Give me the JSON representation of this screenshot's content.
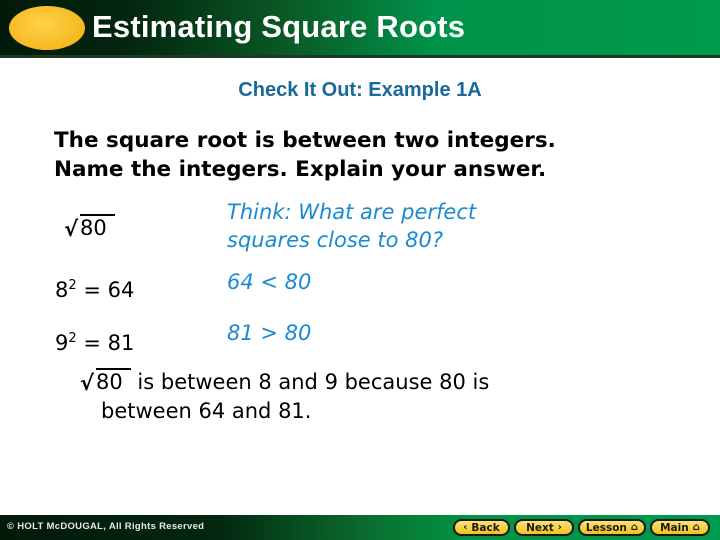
{
  "header": {
    "title": "Estimating Square Roots",
    "accent_color": "#f6b820"
  },
  "subtitle": "Check It Out: Example 1A",
  "prompt": {
    "line1": "The square root is between two integers.",
    "line2": "Name the integers. Explain your answer."
  },
  "work": {
    "radicand": "80",
    "think_line1": "Think: What are perfect",
    "think_line2": "squares close to 80?",
    "rows": [
      {
        "base": "8",
        "exp": "2",
        "rest": " = 64",
        "note": "64 < 80"
      },
      {
        "base": "9",
        "exp": "2",
        "rest": " = 81",
        "note": "81 > 80"
      }
    ]
  },
  "conclusion": {
    "radicand": "80",
    "line1_rest": " is between 8 and 9 because 80 is",
    "line2": "between 64 and 81."
  },
  "footer": {
    "copyright": "© HOLT McDOUGAL, All Rights Reserved",
    "buttons": [
      {
        "label": "Back",
        "icon": "chevron-left"
      },
      {
        "label": "Next",
        "icon": "chevron-right"
      },
      {
        "label": "Lesson",
        "icon": "home"
      },
      {
        "label": "Main",
        "icon": "home"
      }
    ]
  }
}
